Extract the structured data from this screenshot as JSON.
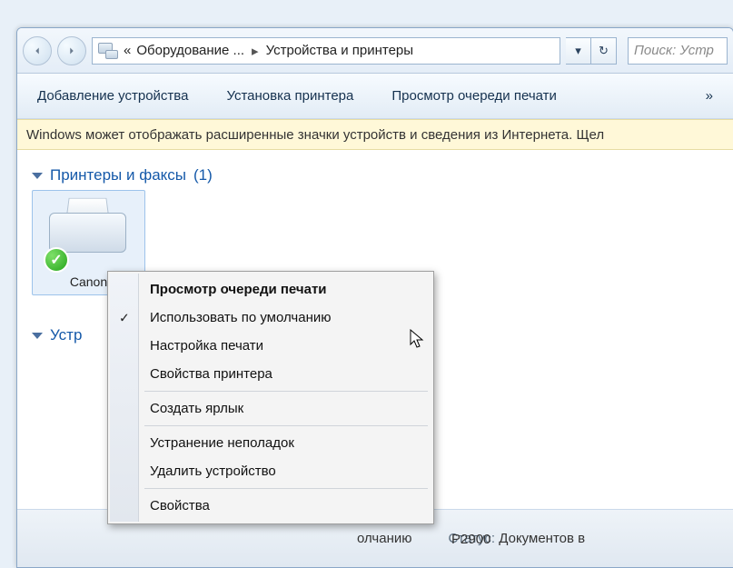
{
  "nav": {
    "crumb_prefix": "«",
    "crumb1": "Оборудование ...",
    "crumb2": "Устройства и принтеры",
    "search_placeholder": "Поиск: Устр"
  },
  "toolbar": {
    "add_device": "Добавление устройства",
    "install_printer": "Установка принтера",
    "view_queue": "Просмотр очереди печати",
    "overflow": "»"
  },
  "infobar": {
    "text": "Windows может отображать расширенные значки устройств и сведения из Интернета.   Щел"
  },
  "groups": {
    "printers_label": "Принтеры и факсы",
    "printers_count": "(1)",
    "devices_label": "Устр"
  },
  "printer": {
    "name": "Canon"
  },
  "context_menu": {
    "view_queue": "Просмотр очереди печати",
    "set_default": "Использовать по умолчанию",
    "print_settings": "Настройка печати",
    "printer_props": "Свойства принтера",
    "create_shortcut": "Создать ярлык",
    "troubleshoot": "Устранение неполадок",
    "remove": "Удалить устройство",
    "properties": "Свойства"
  },
  "details": {
    "default_suffix": "олчанию",
    "model_suffix": "P2900",
    "status_label": "Статус:",
    "status_value": "Документов в"
  }
}
